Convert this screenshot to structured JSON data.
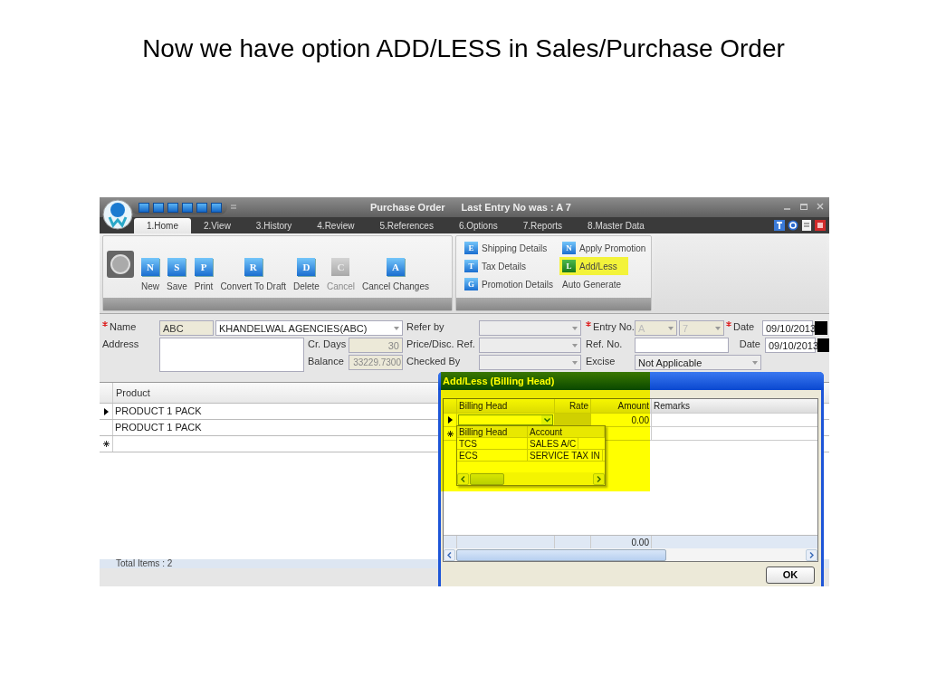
{
  "slide_title": "Now we have option ADD/LESS in Sales/Purchase Order",
  "window": {
    "title": "Purchase Order",
    "subtitle": "Last Entry No was : A 7"
  },
  "tabs": [
    {
      "label": "1.Home",
      "selected": true
    },
    {
      "label": "2.View",
      "selected": false
    },
    {
      "label": "3.History",
      "selected": false
    },
    {
      "label": "4.Review",
      "selected": false
    },
    {
      "label": "5.References",
      "selected": false
    },
    {
      "label": "6.Options",
      "selected": false
    },
    {
      "label": "7.Reports",
      "selected": false
    },
    {
      "label": "8.Master Data",
      "selected": false
    }
  ],
  "ribbon": {
    "buttons": [
      {
        "label": "New",
        "icon_letter": "N",
        "disabled": false
      },
      {
        "label": "Save",
        "icon_letter": "S",
        "disabled": false
      },
      {
        "label": "Print",
        "icon_letter": "P",
        "disabled": false
      },
      {
        "label": "Convert To Draft",
        "icon_letter": "R",
        "disabled": false
      },
      {
        "label": "Delete",
        "icon_letter": "D",
        "disabled": false
      },
      {
        "label": "Cancel",
        "icon_letter": "C",
        "disabled": true
      },
      {
        "label": "Cancel Changes",
        "icon_letter": "A",
        "disabled": false
      }
    ],
    "options": [
      {
        "label": "Shipping Details",
        "icon_letter": "E",
        "highlighted": false
      },
      {
        "label": "Apply Promotion",
        "icon_letter": "N",
        "highlighted": false
      },
      {
        "label": "Tax Details",
        "icon_letter": "T",
        "highlighted": false
      },
      {
        "label": "Add/Less",
        "icon_letter": "L",
        "highlighted": true
      },
      {
        "label": "Promotion Details",
        "icon_letter": "G",
        "highlighted": false
      },
      {
        "label": "Auto Generate",
        "highlighted": false
      }
    ]
  },
  "form": {
    "name": {
      "label": "Name",
      "required": true,
      "code": "ABC",
      "value": "KHANDELWAL AGENCIES(ABC)"
    },
    "address": {
      "label": "Address"
    },
    "cr_days": {
      "label": "Cr. Days",
      "value": "30"
    },
    "balance": {
      "label": "Balance",
      "value": "33229.7300"
    },
    "refer_by": {
      "label": "Refer by"
    },
    "price_disc_ref": {
      "label": "Price/Disc. Ref."
    },
    "checked_by": {
      "label": "Checked By"
    },
    "entry_no": {
      "label": "Entry No.",
      "required": true,
      "prefix": "A",
      "number": "7"
    },
    "date": {
      "label": "Date",
      "required": true,
      "value": "09/10/2013"
    },
    "ref_no": {
      "label": "Ref. No."
    },
    "date_2": {
      "label": "Date",
      "value": "09/10/2013"
    },
    "excise": {
      "label": "Excise",
      "value": "Not Applicable"
    }
  },
  "grid": {
    "columns": [
      "Product"
    ],
    "rows": [
      {
        "product": "PRODUCT 1 PACK",
        "current": true
      },
      {
        "product": "PRODUCT 1 PACK",
        "current": false
      }
    ],
    "new_row": true,
    "footer": "Total Items : 2"
  },
  "dialog": {
    "title": "Add/Less (Billing Head)",
    "columns": [
      "Billing Head",
      "Rate",
      "Amount",
      "Remarks"
    ],
    "edit_row": {
      "amount": "0.00"
    },
    "dropdown": {
      "columns": [
        "Billing Head",
        "Account"
      ],
      "rows": [
        [
          "TCS",
          "SALES A/C"
        ],
        [
          "ECS",
          "SERVICE TAX IN"
        ]
      ]
    },
    "total_amount": "0.00",
    "ok_button": "OK",
    "highlighted": true
  }
}
